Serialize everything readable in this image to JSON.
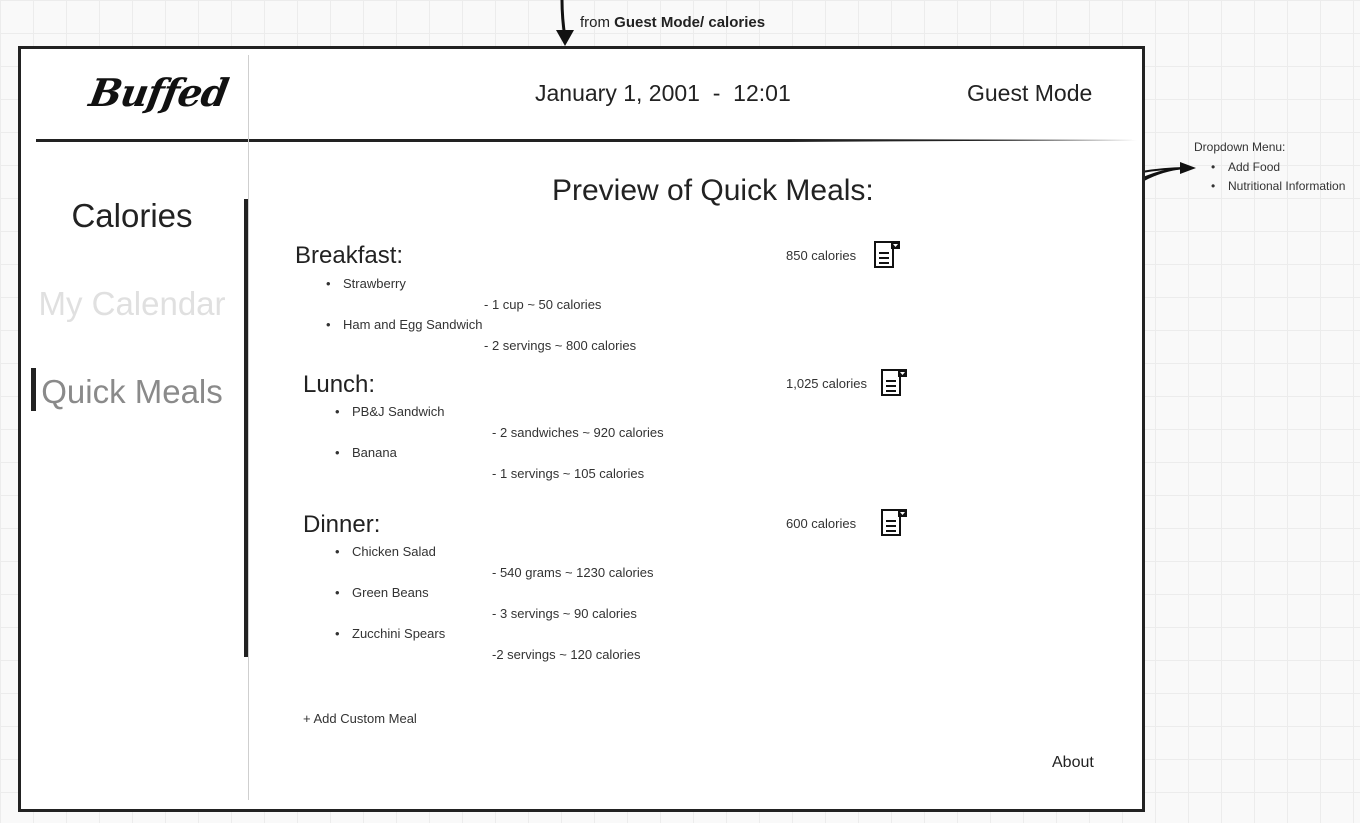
{
  "annotation": {
    "from_prefix": "from ",
    "from_target": "Guest Mode/ calories"
  },
  "header": {
    "logo": "Buffed",
    "datetime": "January 1, 2001  -  12:01",
    "mode": "Guest Mode"
  },
  "sidebar": {
    "items": [
      {
        "label": "Calories"
      },
      {
        "label": "My Calendar"
      },
      {
        "label": "Quick Meals"
      }
    ]
  },
  "main": {
    "title": "Preview of Quick Meals:",
    "meals": [
      {
        "name": "Breakfast:",
        "calories": "850 calories",
        "items": [
          {
            "name": "Strawberry",
            "detail": "- 1 cup ~ 50 calories"
          },
          {
            "name": "Ham and Egg Sandwich",
            "detail": "- 2 servings ~ 800 calories"
          }
        ]
      },
      {
        "name": "Lunch:",
        "calories": "1,025 calories",
        "items": [
          {
            "name": "PB&J Sandwich",
            "detail": "- 2 sandwiches ~ 920 calories"
          },
          {
            "name": "Banana",
            "detail": "- 1 servings ~ 105 calories"
          }
        ]
      },
      {
        "name": "Dinner:",
        "calories": "600 calories",
        "items": [
          {
            "name": "Chicken Salad",
            "detail": "- 540 grams ~ 1230 calories"
          },
          {
            "name": "Green Beans",
            "detail": "- 3 servings ~ 90 calories"
          },
          {
            "name": "Zucchini Spears",
            "detail": "-2 servings ~ 120 calories"
          }
        ]
      }
    ],
    "add_custom": "+ Add Custom Meal"
  },
  "footer": {
    "about": "About"
  },
  "dropdown_note": {
    "label": "Dropdown Menu:",
    "items": [
      "Add Food",
      "Nutritional Information"
    ]
  }
}
